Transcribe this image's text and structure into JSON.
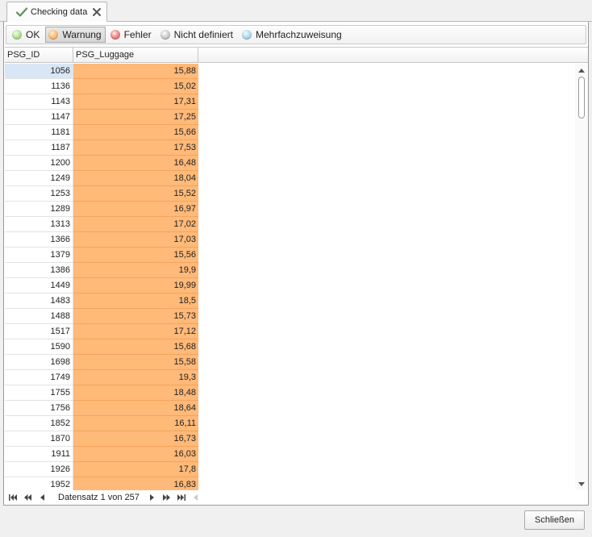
{
  "tab": {
    "title": "Checking data",
    "icon": "checkmark-icon"
  },
  "toolbar": {
    "buttons": [
      {
        "label": "OK",
        "status": "ok",
        "color": "#8cc96b"
      },
      {
        "label": "Warnung",
        "status": "warning",
        "color": "#ffb56a",
        "active": true
      },
      {
        "label": "Fehler",
        "status": "error",
        "color": "#e96b6b"
      },
      {
        "label": "Nicht definiert",
        "status": "undefined",
        "color": "#bdbdbd"
      },
      {
        "label": "Mehrfachzuweisung",
        "status": "multiple",
        "color": "#a3d0e6"
      }
    ]
  },
  "grid": {
    "columns": [
      "PSG_ID",
      "PSG_Luggage"
    ],
    "highlight_color": "#ffb978",
    "rows": [
      [
        "1056",
        "15,88"
      ],
      [
        "1136",
        "15,02"
      ],
      [
        "1143",
        "17,31"
      ],
      [
        "1147",
        "17,25"
      ],
      [
        "1181",
        "15,66"
      ],
      [
        "1187",
        "17,53"
      ],
      [
        "1200",
        "16,48"
      ],
      [
        "1249",
        "18,04"
      ],
      [
        "1253",
        "15,52"
      ],
      [
        "1289",
        "16,97"
      ],
      [
        "1313",
        "17,02"
      ],
      [
        "1366",
        "17,03"
      ],
      [
        "1379",
        "15,56"
      ],
      [
        "1386",
        "19,9"
      ],
      [
        "1449",
        "19,99"
      ],
      [
        "1483",
        "18,5"
      ],
      [
        "1488",
        "15,73"
      ],
      [
        "1517",
        "17,12"
      ],
      [
        "1590",
        "15,68"
      ],
      [
        "1698",
        "15,58"
      ],
      [
        "1749",
        "19,3"
      ],
      [
        "1755",
        "18,48"
      ],
      [
        "1756",
        "18,64"
      ],
      [
        "1852",
        "16,11"
      ],
      [
        "1870",
        "16,73"
      ],
      [
        "1911",
        "16,03"
      ],
      [
        "1926",
        "17,8"
      ],
      [
        "1952",
        "16,83"
      ]
    ]
  },
  "navigator": {
    "text": "Datensatz 1 von 257"
  },
  "footer": {
    "close_label": "Schließen"
  }
}
